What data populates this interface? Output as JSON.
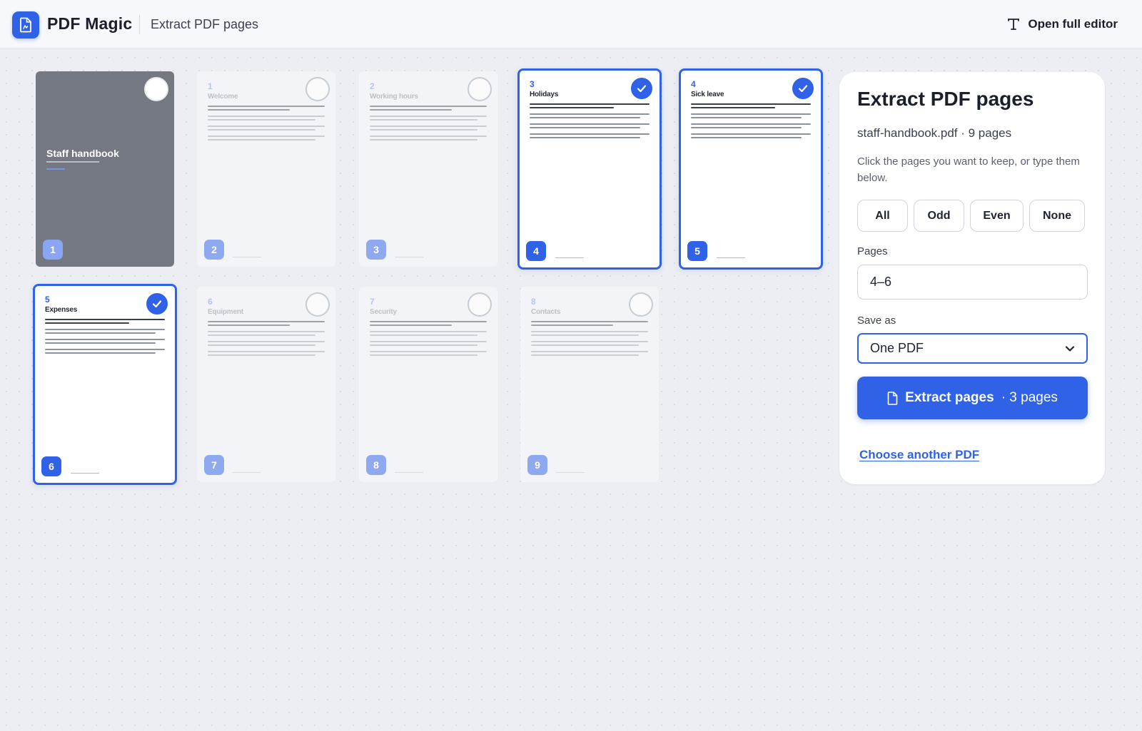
{
  "header": {
    "brand": "PDF Magic",
    "subtitle": "Extract PDF pages",
    "open_editor_label": "Open full editor"
  },
  "pages": [
    {
      "index": "1",
      "label": "",
      "title": "Staff handbook",
      "selected": false,
      "cover": true
    },
    {
      "index": "2",
      "label": "1",
      "title": "Welcome",
      "selected": false
    },
    {
      "index": "3",
      "label": "2",
      "title": "Working hours",
      "selected": false
    },
    {
      "index": "4",
      "label": "3",
      "title": "Holidays",
      "selected": true
    },
    {
      "index": "5",
      "label": "4",
      "title": "Sick leave",
      "selected": true
    },
    {
      "index": "6",
      "label": "5",
      "title": "Expenses",
      "selected": true
    },
    {
      "index": "7",
      "label": "6",
      "title": "Equipment",
      "selected": false
    },
    {
      "index": "8",
      "label": "7",
      "title": "Security",
      "selected": false
    },
    {
      "index": "9",
      "label": "8",
      "title": "Contacts",
      "selected": false
    }
  ],
  "panel": {
    "title": "Extract PDF pages",
    "file_info": "staff-handbook.pdf · 9 pages",
    "help_text": "Click the pages you want to keep, or type them below.",
    "quick_select": [
      "All",
      "Odd",
      "Even",
      "None"
    ],
    "pages_label": "Pages",
    "pages_value": "4–6",
    "save_as_label": "Save as",
    "save_as_value": "One PDF",
    "extract_label": "Extract pages",
    "extract_count": "· 3 pages",
    "choose_another": "Choose another PDF"
  },
  "colors": {
    "accent": "#2f62e6",
    "background": "#eceef3",
    "cover": "#747880"
  }
}
